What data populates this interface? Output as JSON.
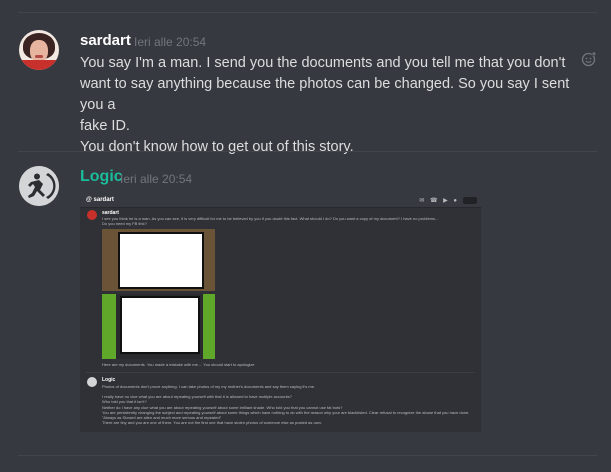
{
  "messages": [
    {
      "username": "sardart",
      "username_color": "#ffffff",
      "timestamp": "Ieri alle 20:54",
      "lines": [
        "You say I'm a man. I send you the documents and you tell me that you don't",
        "want to say anything because the photos can be changed. So you say I sent you a",
        "fake ID.",
        "You don't know how to get out of this story."
      ]
    },
    {
      "username": "Logic",
      "username_color": "#1abc9c",
      "timestamp": "Ieri alle 20:54"
    }
  ],
  "embed": {
    "channel": "sardart",
    "first_author": "sardart",
    "first_lines": [
      "I see you think he is a man. As you can see, it is very difficult for me to be believed by you if you doubt this fact. What should I do? Do you want a copy of my document? I have no problems...",
      "Do you need my FB link?"
    ],
    "caption": "Here are my documents. You made a mistake with me.... You should start to apologize",
    "second_author": "Logic",
    "second_lines": [
      "Photos of documents don't prove anything. I can take photos of my my mother's documents and say them saying it's me.",
      "",
      "I really have no clue what you are about repeating yourself with that it is allowed to have multiple accounts?",
      "Who told you that it isn't?",
      "Neither do I have any clue what you are about repeating yourself about some brilliant shade. Who told you that you cannot use fat bots?",
      "You are persistently changing the subject and repeating yourself about some things which have nothing to do with the reason why your are blacklisted. Clear refusal to recognize the abuse that you have done.",
      "\"Always as Slowed are alien and much more serious and repeated\"",
      "There are tiny and you are one of them. You are not the first one that have stolen photos of someone else as posted as own."
    ]
  },
  "colors": {
    "background": "#36393f",
    "timestamp": "#72767d",
    "text": "#dcddde",
    "accent_logic": "#1abc9c"
  },
  "icons": {
    "add_reaction": "emoji-add-icon"
  }
}
